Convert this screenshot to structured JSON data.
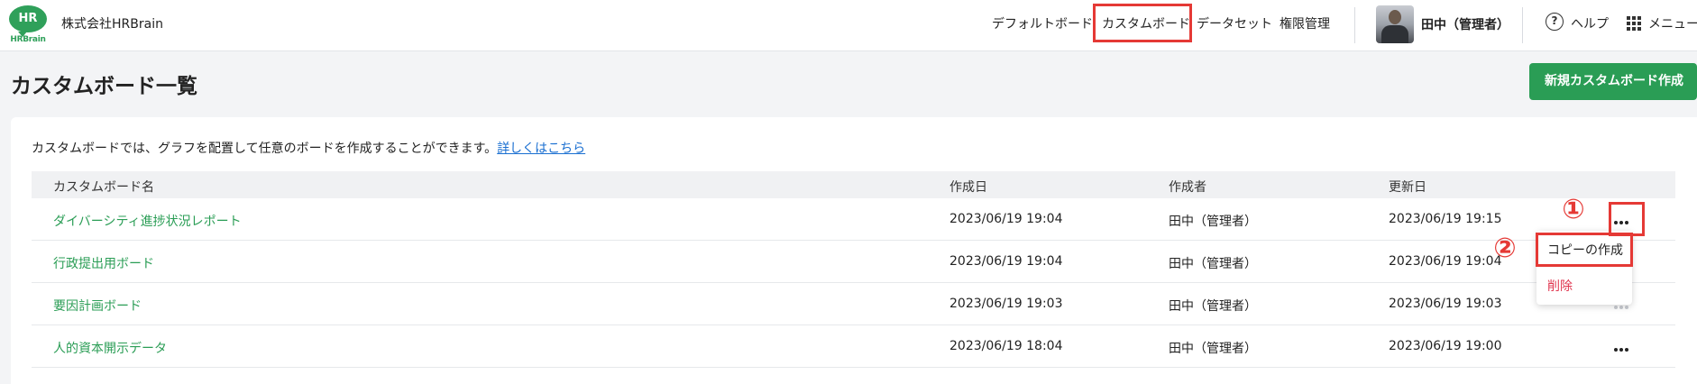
{
  "header": {
    "logo_mark": "HR",
    "logo_text": "HRBrain",
    "company": "株式会社HRBrain",
    "nav": [
      "デフォルトボード",
      "カスタムボード",
      "データセット",
      "権限管理"
    ],
    "user_name": "田中（管理者）",
    "help_icon": "?",
    "help_label": "ヘルプ",
    "menu_label": "メニュー"
  },
  "page": {
    "title": "カスタムボード一覧",
    "new_button": "新規カスタムボード作成",
    "description": "カスタムボードでは、グラフを配置して任意のボードを作成することができます。",
    "description_link": "詳しくはこちら"
  },
  "table": {
    "headers": [
      "カスタムボード名",
      "作成日",
      "作成者",
      "更新日"
    ],
    "rows": [
      {
        "name": "ダイバーシティ進捗状況レポート",
        "created": "2023/06/19 19:04",
        "author": "田中（管理者）",
        "updated": "2023/06/19 19:15"
      },
      {
        "name": "行政提出用ボード",
        "created": "2023/06/19 19:04",
        "author": "田中（管理者）",
        "updated": "2023/06/19 19:04"
      },
      {
        "name": "要因計画ボード",
        "created": "2023/06/19 19:03",
        "author": "田中（管理者）",
        "updated": "2023/06/19 19:03"
      },
      {
        "name": "人的資本開示データ",
        "created": "2023/06/19 18:04",
        "author": "田中（管理者）",
        "updated": "2023/06/19 19:00"
      }
    ]
  },
  "dropdown": {
    "copy": "コピーの作成",
    "delete": "削除"
  },
  "annotations": {
    "step1": "①",
    "step2": "②",
    "color": "#e53935"
  },
  "colors": {
    "brand_green": "#2a9d55",
    "link_blue": "#1a6fd1",
    "delete_red": "#e0364f"
  }
}
